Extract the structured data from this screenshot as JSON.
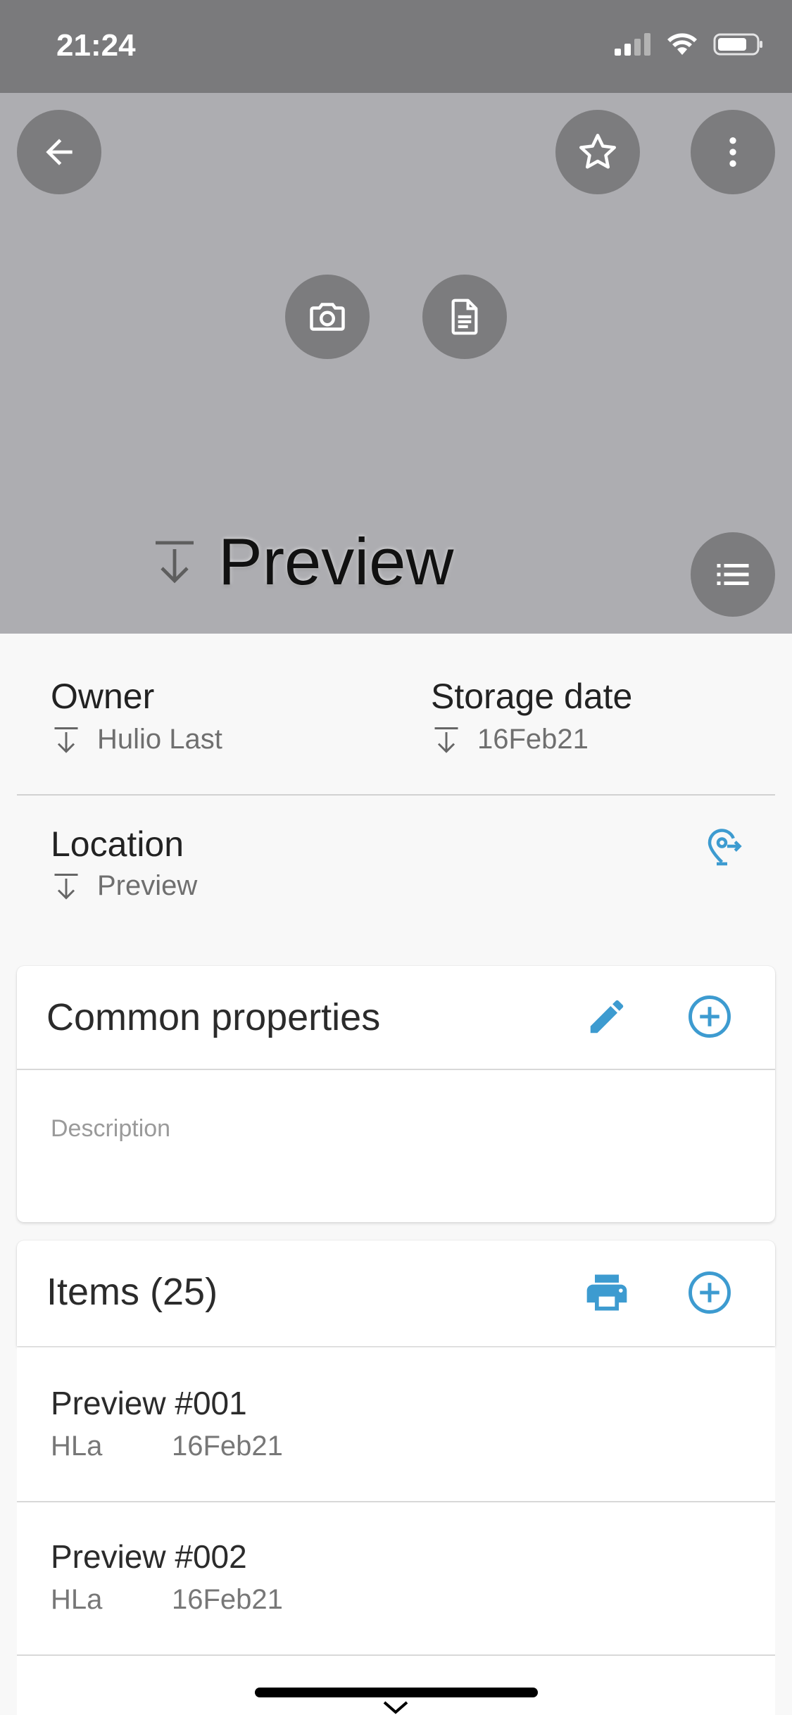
{
  "status_bar": {
    "time": "21:24",
    "icons": [
      "signal-icon",
      "wifi-icon",
      "battery-icon"
    ]
  },
  "hero": {
    "title": "Preview",
    "buttons": [
      "back-arrow-icon",
      "star-icon",
      "more-vert-icon",
      "camera-icon",
      "document-icon",
      "list-icon"
    ]
  },
  "owner": {
    "label": "Owner",
    "value": "Hulio Last"
  },
  "storage": {
    "label": "Storage date",
    "value": "16Feb21"
  },
  "location": {
    "label": "Location",
    "value": "Preview"
  },
  "common_properties": {
    "title": "Common properties",
    "description_placeholder": "Description"
  },
  "items": {
    "title": "Items (25)",
    "list": [
      {
        "name": "Preview #001",
        "owner": "HLa",
        "date": "16Feb21"
      },
      {
        "name": "Preview #002",
        "owner": "HLa",
        "date": "16Feb21"
      }
    ]
  },
  "colors": {
    "accent": "#3d9bd0",
    "hero_bg": "#adadb1",
    "status_bg": "#7a7a7c",
    "button_bg": "#7c7c7e"
  }
}
